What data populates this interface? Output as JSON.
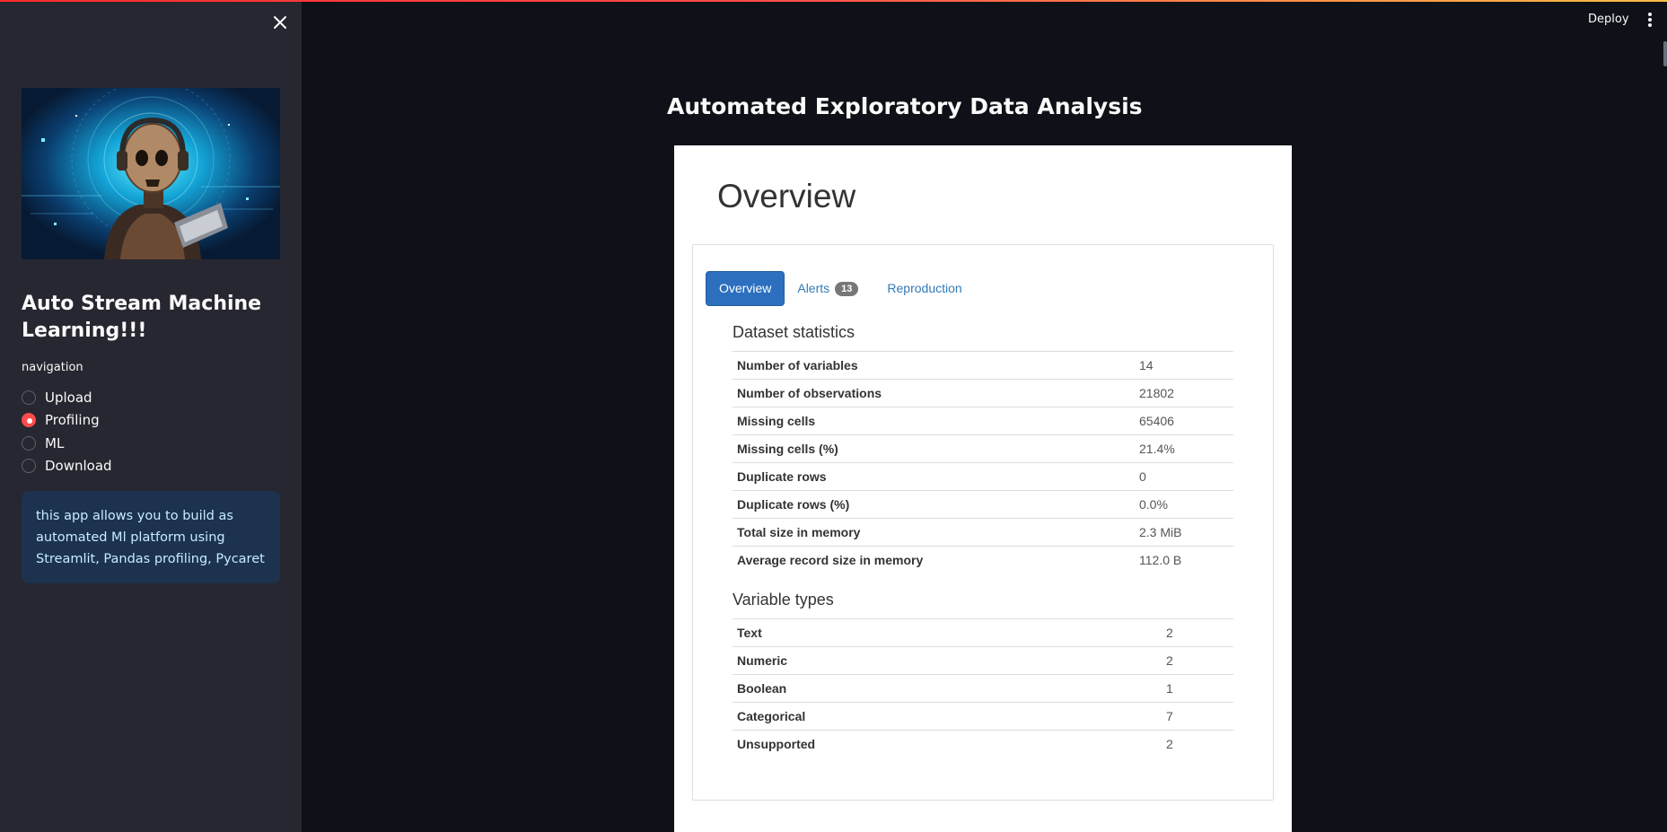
{
  "sidebar": {
    "close_icon": "close-icon",
    "hero_image": "ai-robot-with-laptop-illustration",
    "app_title": "Auto Stream Machine Learning!!!",
    "nav_label": "navigation",
    "nav_options": [
      "Upload",
      "Profiling",
      "ML",
      "Download"
    ],
    "nav_selected": "Profiling",
    "info_text": "this app allows you to build as automated Ml platform using Streamlit, Pandas profiling, Pycaret"
  },
  "header": {
    "deploy_label": "Deploy",
    "menu_icon": "kebab-menu-icon"
  },
  "main": {
    "page_title": "Automated Exploratory Data Analysis"
  },
  "report": {
    "heading": "Overview",
    "tabs": [
      {
        "label": "Overview",
        "active": true
      },
      {
        "label": "Alerts",
        "badge": "13",
        "active": false
      },
      {
        "label": "Reproduction",
        "active": false
      }
    ],
    "dataset_statistics": {
      "title": "Dataset statistics",
      "rows": [
        {
          "label": "Number of variables",
          "value": "14"
        },
        {
          "label": "Number of observations",
          "value": "21802"
        },
        {
          "label": "Missing cells",
          "value": "65406"
        },
        {
          "label": "Missing cells (%)",
          "value": "21.4%"
        },
        {
          "label": "Duplicate rows",
          "value": "0"
        },
        {
          "label": "Duplicate rows (%)",
          "value": "0.0%"
        },
        {
          "label": "Total size in memory",
          "value": "2.3 MiB"
        },
        {
          "label": "Average record size in memory",
          "value": "112.0 B"
        }
      ]
    },
    "variable_types": {
      "title": "Variable types",
      "rows": [
        {
          "label": "Text",
          "value": "2"
        },
        {
          "label": "Numeric",
          "value": "2"
        },
        {
          "label": "Boolean",
          "value": "1"
        },
        {
          "label": "Categorical",
          "value": "7"
        },
        {
          "label": "Unsupported",
          "value": "2"
        }
      ]
    }
  },
  "colors": {
    "accent": "#ff4b4b",
    "sidebar_bg": "#262730",
    "main_bg": "#0e1117",
    "info_bg": "#1c324f",
    "tab_active": "#2c6fbf"
  }
}
